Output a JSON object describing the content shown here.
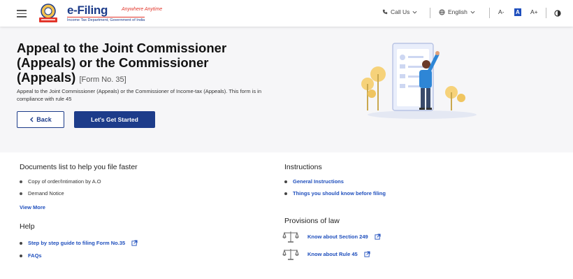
{
  "header": {
    "logo_title": "e-Filing",
    "logo_tagline": "Anywhere Anytime",
    "logo_subtitle": "Income Tax Department, Government of India",
    "call_us": "Call Us",
    "language": "English",
    "font_decrease": "A-",
    "font_default": "A",
    "font_increase": "A+"
  },
  "hero": {
    "title": "Appeal to the Joint Commissioner (Appeals) or the Commissioner (Appeals)",
    "form_no": "[Form No. 35]",
    "description": "Appeal to the Joint Commissioner (Appeals) or the Commissioner of Income-tax (Appeals). This form is in compliance with rule 45",
    "back_label": "Back",
    "start_label": "Let's Get Started"
  },
  "documents": {
    "title": "Documents list to help you file faster",
    "items": [
      "Copy of order/Intimation by A.O",
      "Demand Notice"
    ],
    "view_more": "View More"
  },
  "help": {
    "title": "Help",
    "items": [
      "Step by step guide to filing Form No.35",
      "FAQs"
    ]
  },
  "instructions": {
    "title": "Instructions",
    "items": [
      "General Instructions",
      "Things you should know before filing"
    ]
  },
  "provisions": {
    "title": "Provisions of law",
    "items": [
      "Know about Section 249",
      "Know about Rule 45"
    ]
  },
  "colors": {
    "primary": "#1d3c8a",
    "link": "#1f4fbd",
    "hero_bg": "#f6f6f8"
  }
}
